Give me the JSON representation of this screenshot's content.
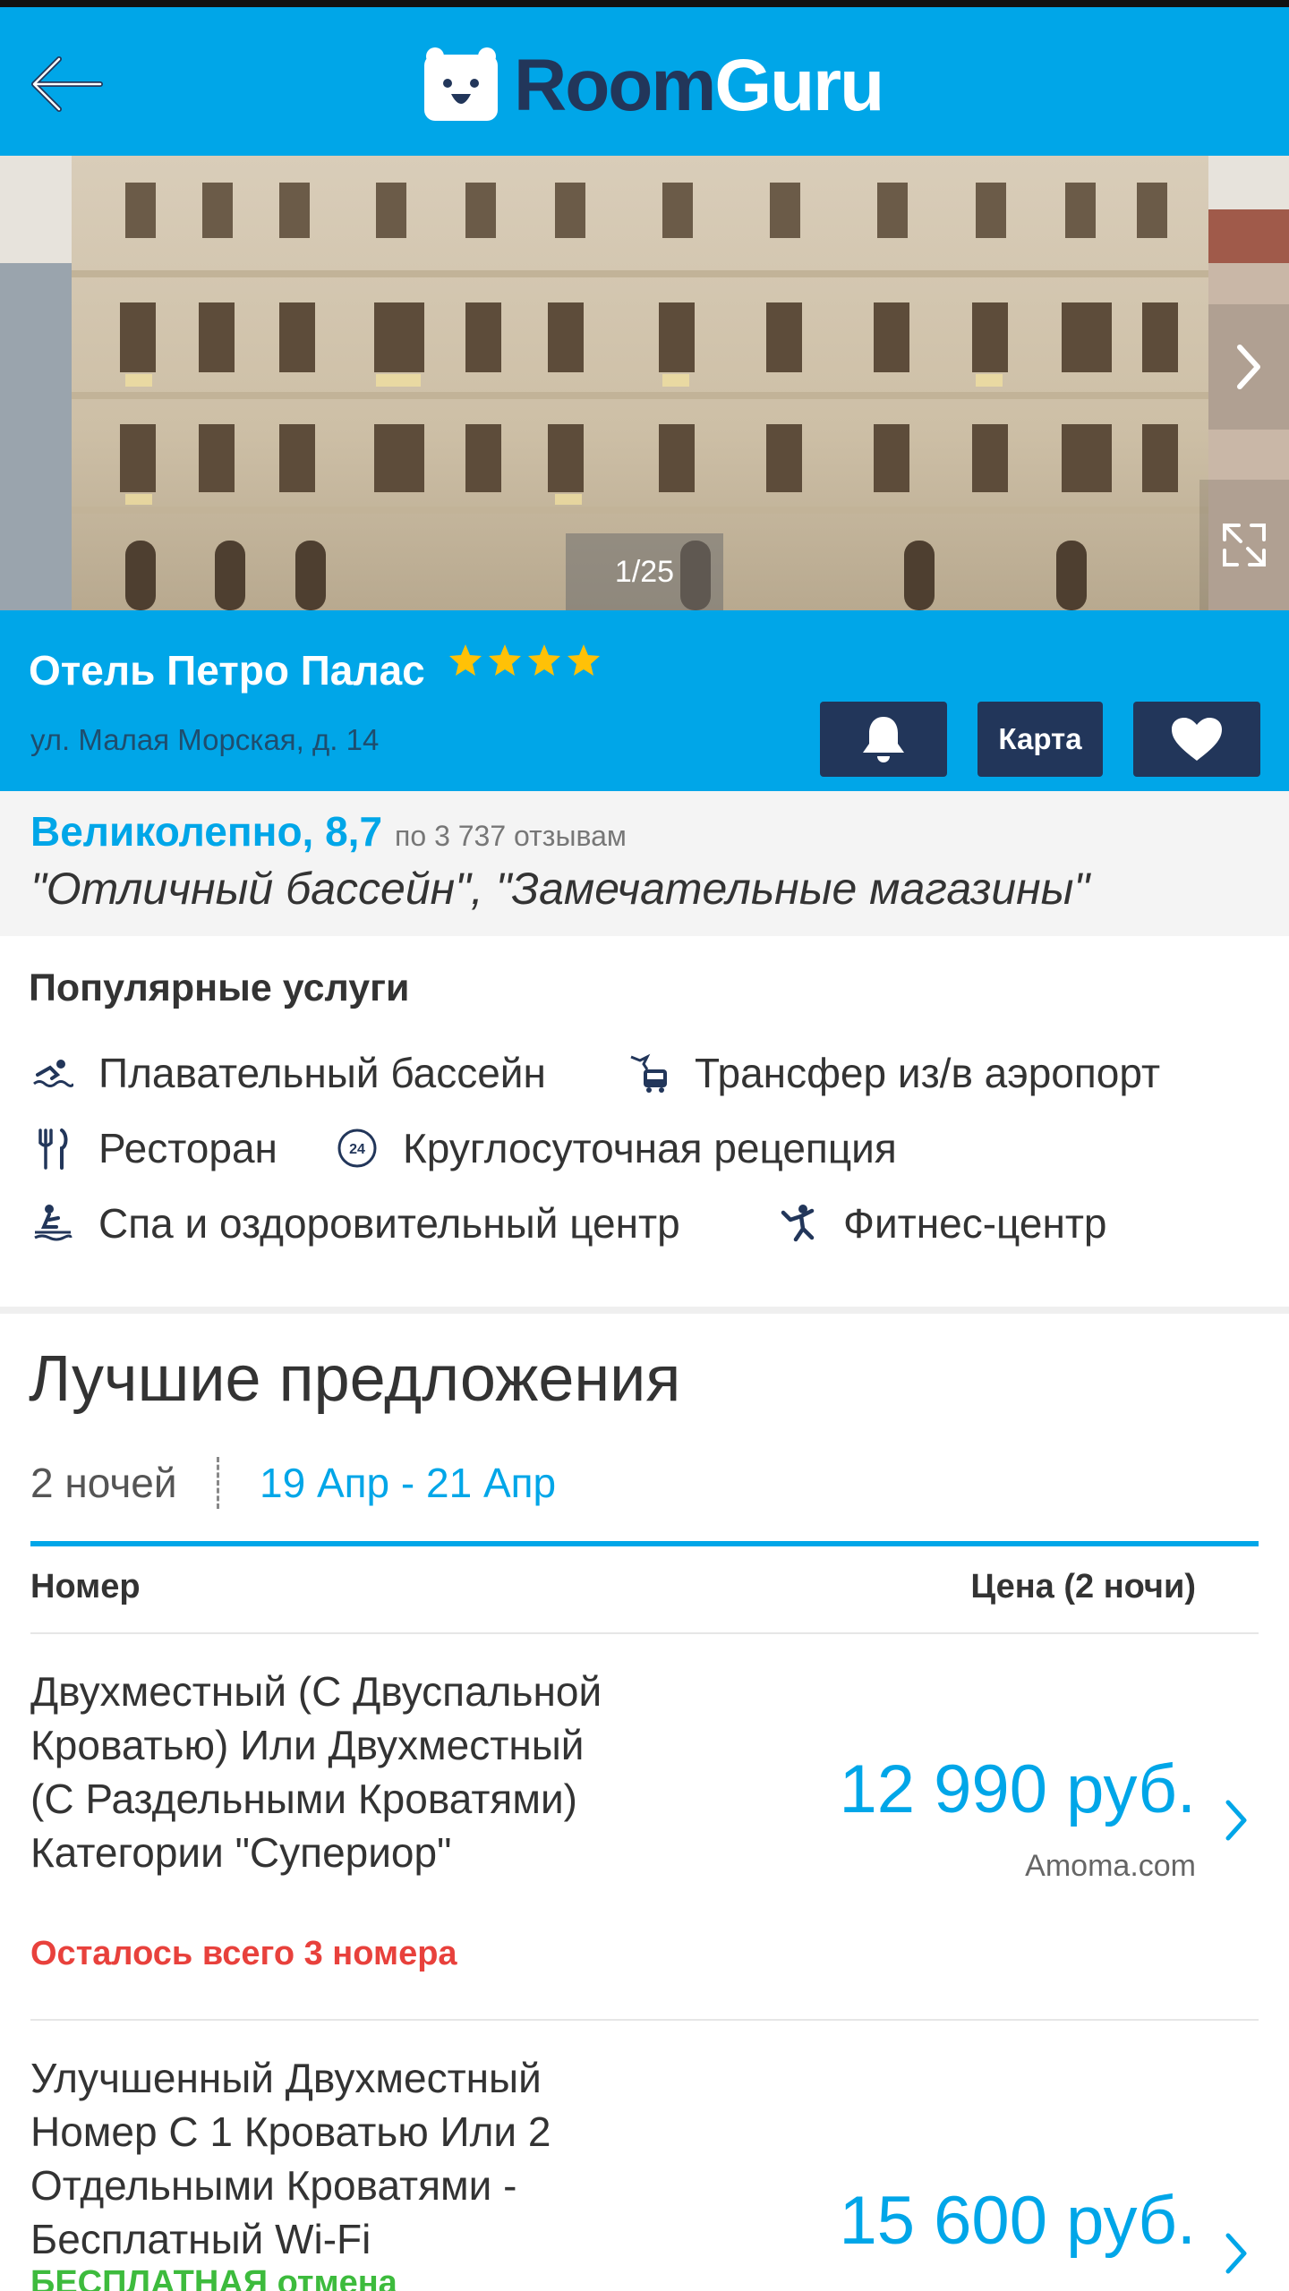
{
  "header": {
    "logo_room": "Room",
    "logo_guru": "Guru",
    "back_icon": "arrow-left-icon"
  },
  "gallery": {
    "counter": "1/25",
    "next_icon": "chevron-right-icon",
    "expand_icon": "expand-icon"
  },
  "hotel": {
    "name": "Отель Петро Палас",
    "stars": 4,
    "address": "ул. Малая Морская, д. 14",
    "map_label": "Карта",
    "bell_icon": "bell-icon",
    "favorite_icon": "heart-icon"
  },
  "rating": {
    "label": "Великолепно, 8,7",
    "count": "по 3 737 отзывам",
    "quote": "\"Отличный бассейн\", \"Замечательные магазины\""
  },
  "amenities": {
    "title": "Популярные услуги",
    "items": [
      {
        "icon": "swimmer-icon",
        "label": "Плавательный бассейн"
      },
      {
        "icon": "airport-shuttle-icon",
        "label": "Трансфер из/в аэропорт"
      },
      {
        "icon": "fork-knife-icon",
        "label": "Ресторан"
      },
      {
        "icon": "clock-24-icon",
        "label": "Круглосуточная рецепция"
      },
      {
        "icon": "spa-icon",
        "label": "Спа и оздоровительный центр"
      },
      {
        "icon": "fitness-icon",
        "label": "Фитнес-центр"
      }
    ]
  },
  "deals": {
    "title": "Лучшие предложения",
    "nights": "2 ночей",
    "dates": "19 Апр - 21 Апр",
    "col_room": "Номер",
    "col_price": "Цена (2 ночи)",
    "offers": [
      {
        "name": "Двухместный (С Двуспальной Кроватью) Или Двухместный (С Раздельными Кроватями) Категории \"Супериор\"",
        "note": "Осталось всего 3 номера",
        "note_color": "#e8413c",
        "price": "12 990 руб.",
        "source": "Amoma.com"
      },
      {
        "name": "Улучшенный Двухместный Номер С 1 Кроватью Или 2 Отдельными Кроватями - Бесплатный Wi-Fi",
        "note": "БЕСПЛАТНАЯ отмена",
        "note_color": "#3dbb3d",
        "price": "15 600 руб."
      }
    ]
  },
  "colors": {
    "brand_blue": "#00a6e8",
    "navy": "#22365a",
    "star": "#ffc107",
    "alert_red": "#e8413c",
    "success_green": "#3dbb3d"
  }
}
